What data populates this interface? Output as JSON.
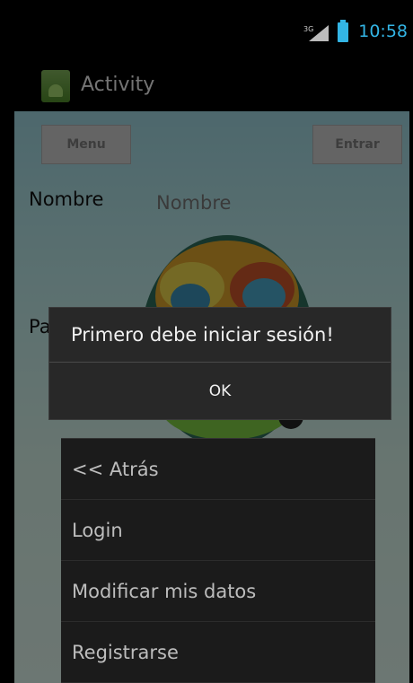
{
  "statusbar": {
    "network": "3G",
    "time": "10:58"
  },
  "actionbar": {
    "title": "Activity"
  },
  "form": {
    "menu_button": "Menu",
    "enter_button": "Entrar",
    "name_label": "Nombre",
    "name_placeholder": "Nombre",
    "password_label_partial": "Pa"
  },
  "dialog": {
    "message": "Primero debe iniciar sesión!",
    "ok": "OK"
  },
  "menu": {
    "items": [
      {
        "label": "<< Atrás"
      },
      {
        "label": "Login"
      },
      {
        "label": "Modificar mis datos"
      },
      {
        "label": "Registrarse"
      }
    ]
  },
  "colors": {
    "accent": "#33b5e5",
    "dialog_bg": "#282828",
    "menu_bg": "#1b1b1b"
  }
}
